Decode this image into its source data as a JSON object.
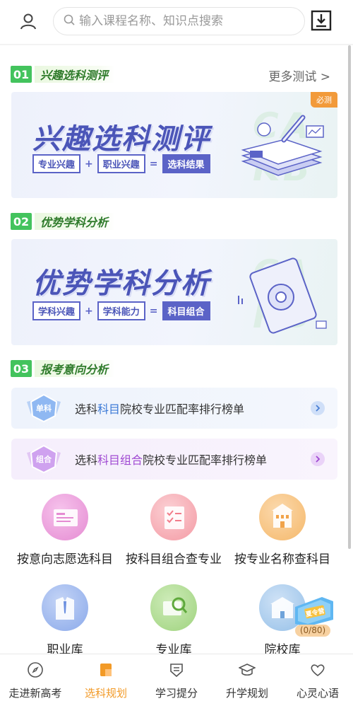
{
  "search": {
    "placeholder": "输入课程名称、知识点搜索"
  },
  "sections": [
    {
      "num": "01",
      "title": "兴趣选科测评",
      "more": "更多测试 >"
    },
    {
      "num": "02",
      "title": "优势学科分析"
    },
    {
      "num": "03",
      "title": "报考意向分析"
    }
  ],
  "banner1": {
    "title": "兴趣选科测评",
    "tag1": "专业兴趣",
    "tag2": "职业兴趣",
    "tag3": "选科结果",
    "op1": "+",
    "op2": "=",
    "badge": "必测"
  },
  "banner2": {
    "title": "优势学科分析",
    "tag1": "学科兴趣",
    "tag2": "学科能力",
    "tag3": "科目组合",
    "op1": "+",
    "op2": "="
  },
  "rank1": {
    "pre": "选科",
    "hl": "科目",
    "post": "院校专业匹配率排行榜单",
    "badge": "单科"
  },
  "rank2": {
    "pre": "选科",
    "hl": "科目组合",
    "post": "院校专业匹配率排行榜单",
    "badge": "组合"
  },
  "grid": [
    {
      "label": "按意向志愿选科目",
      "icon": "document-icon",
      "color": "#e58bd2"
    },
    {
      "label": "按科目组合查专业",
      "icon": "checklist-icon",
      "color": "#f49aa4"
    },
    {
      "label": "按专业名称查科目",
      "icon": "building-icon",
      "color": "#f5b86a"
    },
    {
      "label": "职业库",
      "icon": "suit-icon",
      "color": "#8aa9ea"
    },
    {
      "label": "专业库",
      "icon": "magnifier-icon",
      "color": "#9fd37e"
    },
    {
      "label": "院校库",
      "icon": "school-icon",
      "color": "#95c0e8"
    }
  ],
  "float_badge": {
    "text": "夏令营",
    "count": "(0/80)"
  },
  "nav": [
    {
      "label": "走进新高考",
      "icon": "compass-icon",
      "active": false
    },
    {
      "label": "选科规划",
      "icon": "flag-icon",
      "active": true
    },
    {
      "label": "学习提分",
      "icon": "shield-icon",
      "active": false
    },
    {
      "label": "升学规划",
      "icon": "graduation-cap-icon",
      "active": false
    },
    {
      "label": "心灵心语",
      "icon": "heart-icon",
      "active": false
    }
  ],
  "colors": {
    "accent": "#f29a27",
    "green": "#43c35d",
    "indigo": "#4b55b8"
  }
}
